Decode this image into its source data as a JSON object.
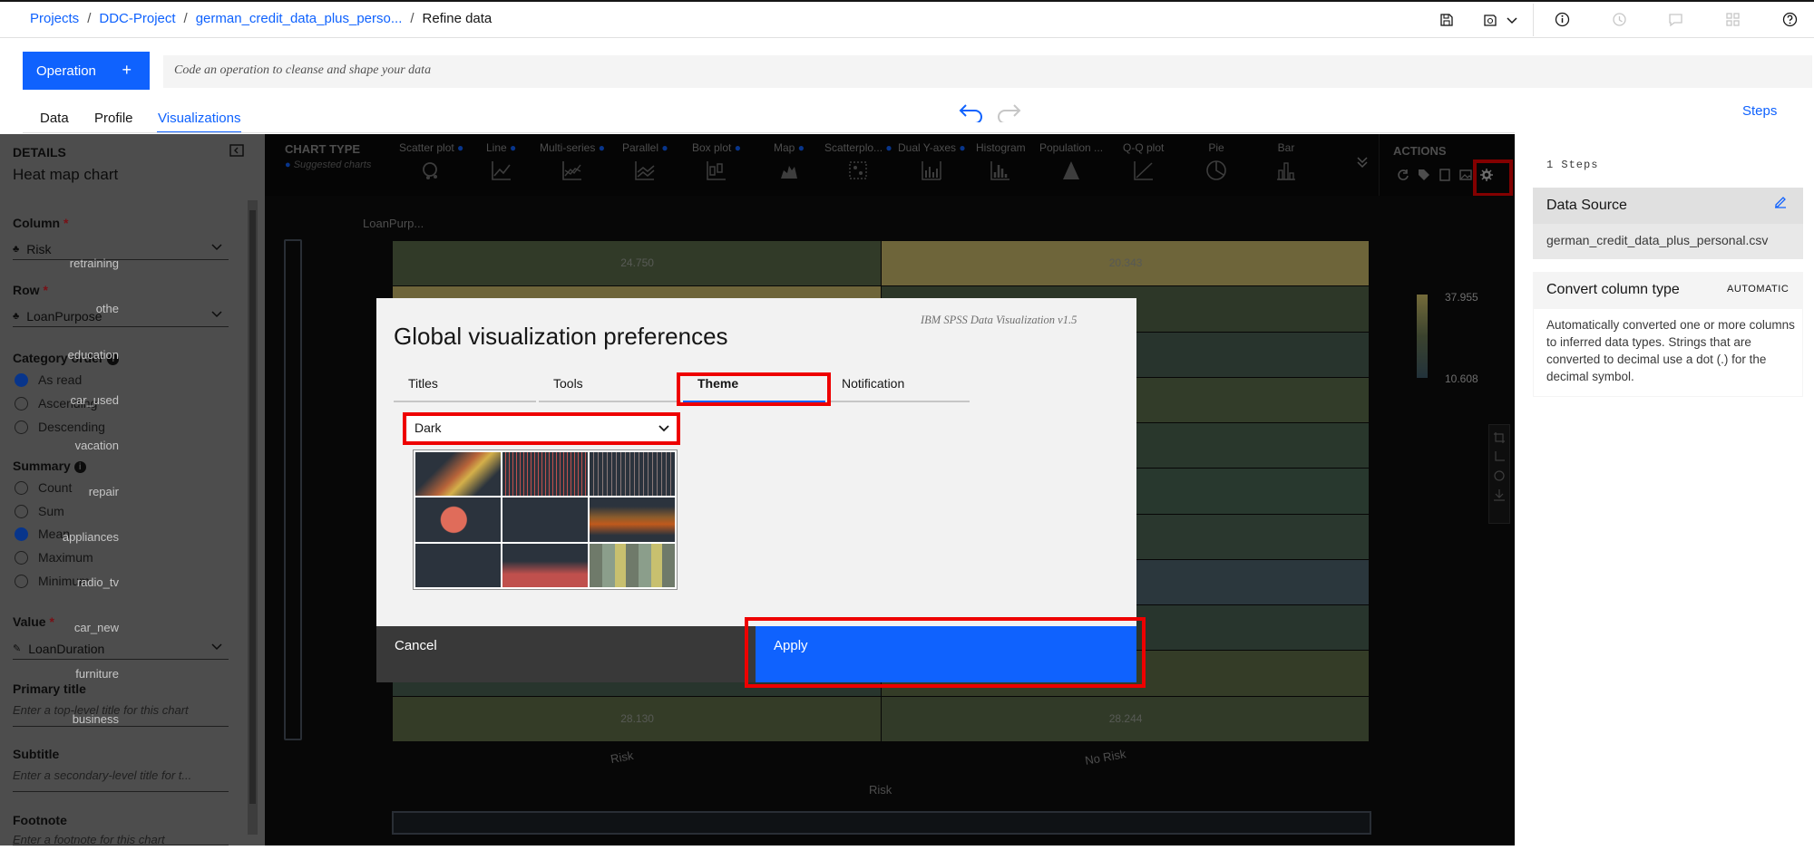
{
  "breadcrumb": {
    "items": [
      "Projects",
      "DDC-Project",
      "german_credit_data_plus_perso...",
      "Refine data"
    ]
  },
  "toolbar": {
    "operation_label": "Operation",
    "code_placeholder": "Code an operation to cleanse and shape your data"
  },
  "tabs": {
    "data": "Data",
    "profile": "Profile",
    "viz": "Visualizations"
  },
  "steps_link": "Steps",
  "details": {
    "heading": "DETAILS",
    "chart_name": "Heat map chart",
    "column_label": "Column",
    "column_value": "Risk",
    "row_label": "Row",
    "row_value": "LoanPurpose",
    "category_order_label": "Category order",
    "order_opts": [
      "As read",
      "Ascending",
      "Descending"
    ],
    "order_selected": "As read",
    "summary_label": "Summary",
    "summary_opts": [
      "Count",
      "Sum",
      "Mean",
      "Maximum",
      "Minimum"
    ],
    "summary_selected": "Mean",
    "value_label": "Value",
    "value_value": "LoanDuration",
    "primary_title_label": "Primary title",
    "primary_title_ph": "Enter a top-level title for this chart",
    "subtitle_label": "Subtitle",
    "subtitle_ph": "Enter a secondary-level title for t...",
    "footnote_label": "Footnote",
    "footnote_ph": "Enter a footnote for this chart"
  },
  "chart_type": {
    "heading": "CHART TYPE",
    "suggested": "Suggested charts",
    "types": [
      "Scatter plot",
      "Line",
      "Multi-series",
      "Parallel",
      "Box plot",
      "Map",
      "Scatterplo...",
      "Dual Y-axes",
      "Histogram",
      "Population ...",
      "Q-Q plot",
      "Pie",
      "Bar"
    ]
  },
  "actions": {
    "heading": "ACTIONS"
  },
  "chart_data": {
    "type": "heatmap",
    "row_axis_title": "LoanPurp...",
    "xlabel": "Risk",
    "columns": [
      "Risk",
      "No Risk"
    ],
    "rows": [
      "retraining",
      "othe",
      "education",
      "car_used",
      "vacation",
      "repair",
      "appliances",
      "radio_tv",
      "car_new",
      "furniture",
      "business"
    ],
    "values": [
      [
        24.75,
        20.343
      ],
      [
        28.13,
        28.244
      ]
    ],
    "values_rows": [
      "retraining",
      "business"
    ],
    "legend_max": "37.955",
    "legend_min": "10.608"
  },
  "steps_panel": {
    "count": "1 Steps",
    "step1_title": "Data Source",
    "step1_file": "german_credit_data_plus_personal.csv",
    "step2_title": "Convert column type",
    "step2_badge": "AUTOMATIC",
    "step2_desc": "Automatically converted one or more columns to inferred data types. Strings that are converted to decimal use a dot (.) for the decimal symbol."
  },
  "dialog": {
    "title": "Global visualization preferences",
    "version": "IBM SPSS Data Visualization v1.5",
    "tabs": [
      "Titles",
      "Tools",
      "Theme",
      "Notification"
    ],
    "active_tab": "Theme",
    "theme_value": "Dark",
    "cancel": "Cancel",
    "apply": "Apply"
  }
}
